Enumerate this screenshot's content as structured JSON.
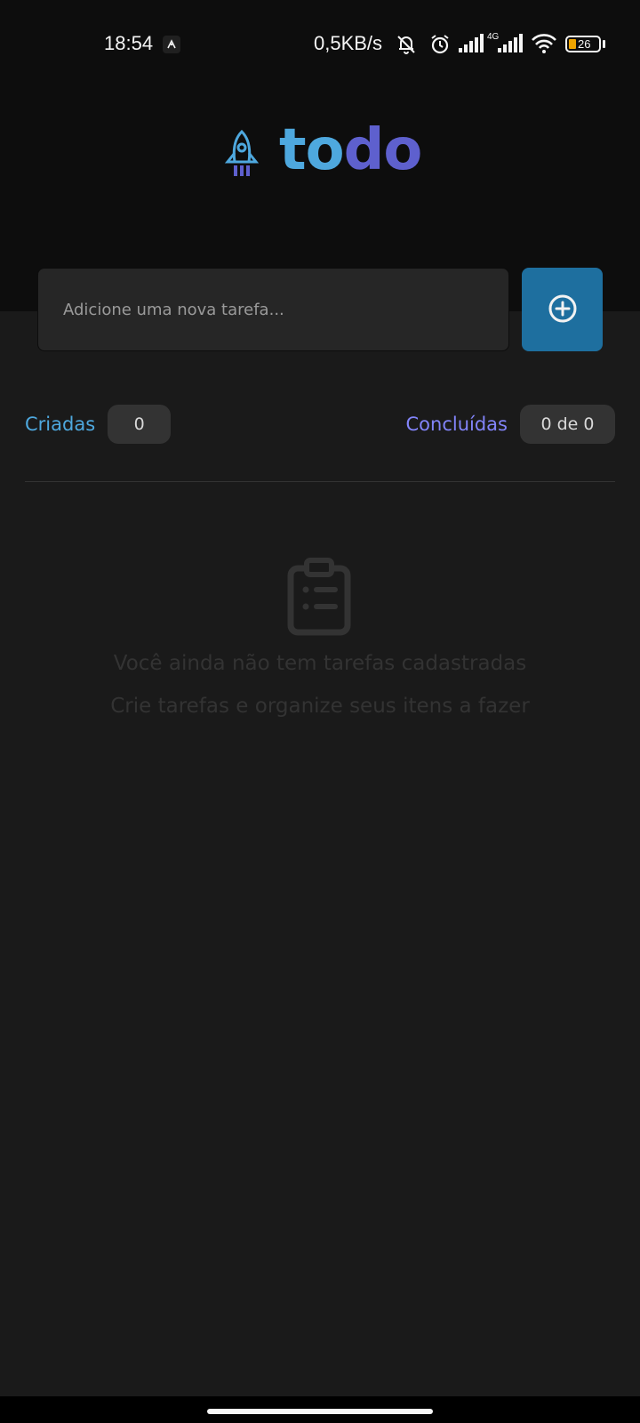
{
  "status_bar": {
    "time": "18:54",
    "network_speed": "0,5KB/s",
    "network_type": "4G",
    "battery_level": "26",
    "icons": [
      "app-notification-icon",
      "bell-muted-icon",
      "alarm-icon",
      "signal-icon",
      "signal-icon",
      "wifi-icon",
      "battery-icon"
    ]
  },
  "logo": {
    "icon": "rocket-icon",
    "text_part1": "to",
    "text_part2": "do",
    "colors": {
      "to": "#4ea8de",
      "do": "#5e60ce"
    }
  },
  "new_task": {
    "placeholder": "Adicione uma nova tarefa...",
    "value": "",
    "add_icon": "plus-circle-icon"
  },
  "counters": {
    "created_label": "Criadas",
    "created_count": "0",
    "done_label": "Concluídas",
    "done_count": "0 de 0"
  },
  "empty_state": {
    "icon": "clipboard-icon",
    "title": "Você ainda não tem tarefas cadastradas",
    "subtitle": "Crie tarefas e organize seus itens a fazer"
  },
  "colors": {
    "header_bg": "#0d0d0d",
    "page_bg": "#1a1a1a",
    "accent_blue": "#4ea8de",
    "accent_purple": "#8284fa",
    "button_blue": "#1e6f9f"
  }
}
